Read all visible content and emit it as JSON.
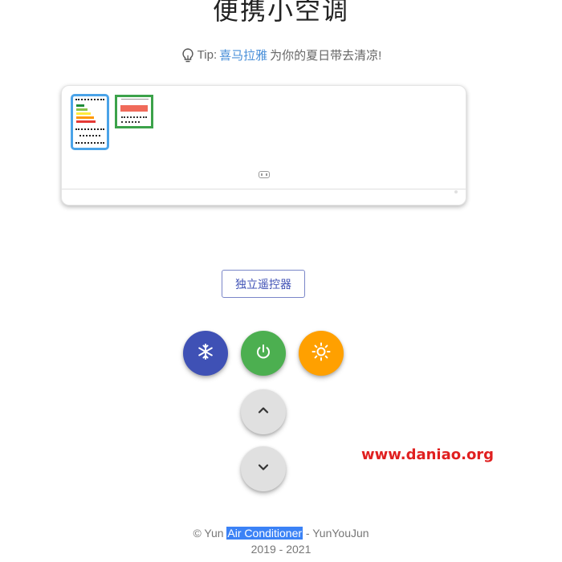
{
  "page": {
    "title": "便携小空调"
  },
  "tip": {
    "prefix": "Tip:",
    "highlight": "喜马拉雅",
    "suffix": "为你的夏日带去清凉!",
    "icon": "lightbulb-icon"
  },
  "controls": {
    "remote_label": "独立遥控器",
    "cold_icon": "snowflake-icon",
    "power_icon": "power-icon",
    "heat_icon": "sun-icon",
    "up_icon": "chevron-up-icon",
    "down_icon": "chevron-down-icon"
  },
  "colors": {
    "cold": "#3f51b5",
    "power": "#4caf50",
    "heat": "#ffa000",
    "neutral": "#e0e0e0",
    "tip_highlight": "#4a90d9"
  },
  "watermark": "www.daniao.org",
  "footer": {
    "copyright_prefix": "© Yun ",
    "selected": "Air Conditioner",
    "copyright_suffix": " - YunYouJun",
    "years": "2019 - 2021"
  }
}
